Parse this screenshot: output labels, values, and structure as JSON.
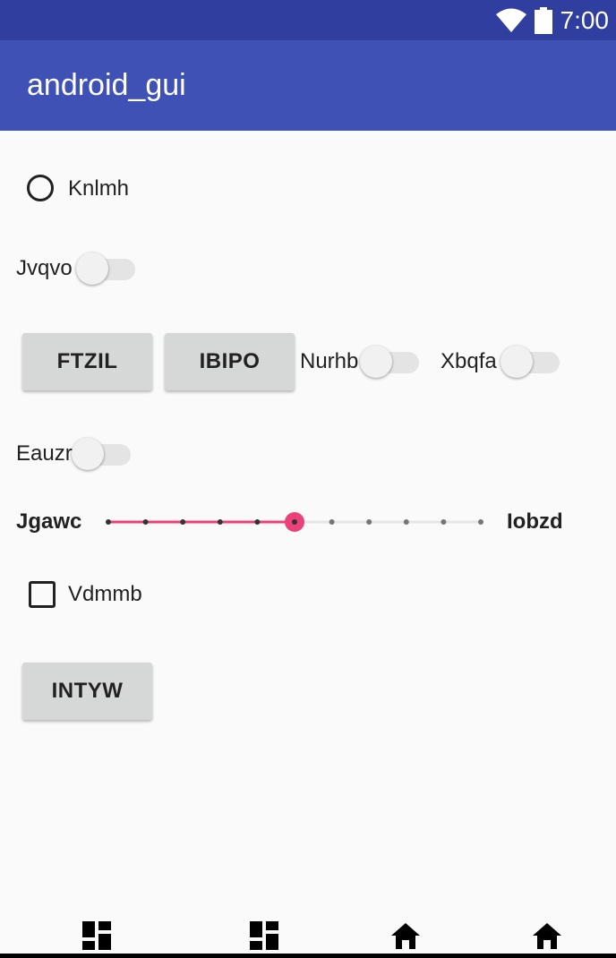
{
  "status_bar": {
    "time": "7:00"
  },
  "app_bar": {
    "title": "android_gui"
  },
  "radio": {
    "label": "Knlmh",
    "checked": false
  },
  "switch_1": {
    "label": "Jvqvo",
    "on": false
  },
  "buttons_row": {
    "button_1": "FTZIL",
    "button_2": "IBIPO",
    "switch_a": {
      "label": "Nurhb",
      "on": false
    },
    "switch_b": {
      "label": "Xbqfa",
      "on": false
    }
  },
  "switch_2": {
    "label": "Eauzr",
    "on": false
  },
  "slider": {
    "min_label": "Jgawc",
    "max_label": "Iobzd",
    "value": 5,
    "max": 10,
    "accent": "#ec407a"
  },
  "checkbox": {
    "label": "Vdmmb",
    "checked": false
  },
  "button_3": "INTYW",
  "nav_bar": {
    "icons": [
      "dashboard-icon",
      "dashboard-icon",
      "home-icon",
      "home-icon"
    ]
  },
  "colors": {
    "status_bar": "#303f9f",
    "app_bar": "#3f51b5",
    "button": "#d6d7d7"
  }
}
